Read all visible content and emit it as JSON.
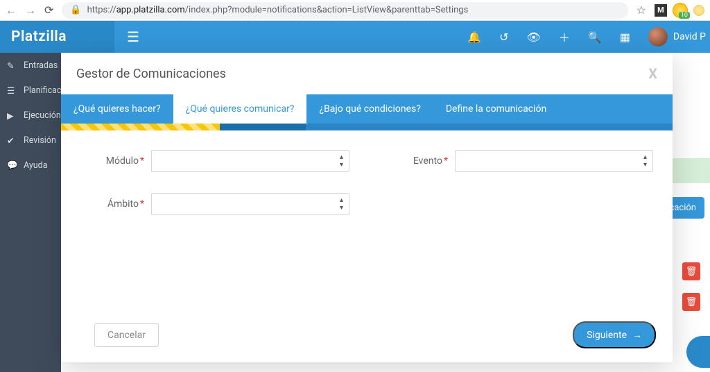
{
  "browser": {
    "url_host": "app.platzilla.com",
    "url_path": "/index.php?module=notifications&action=ListView&parenttab=Settings",
    "ext_m": "M",
    "ext_badge": "10"
  },
  "header": {
    "brand": "Platzilla",
    "user_name": "David P"
  },
  "sidebar": {
    "items": [
      {
        "label": "Entradas"
      },
      {
        "label": "Planificación"
      },
      {
        "label": "Ejecución"
      },
      {
        "label": "Revisión"
      },
      {
        "label": "Ayuda"
      }
    ]
  },
  "bg": {
    "btn_label": "tificación"
  },
  "modal": {
    "title": "Gestor de Comunicaciones",
    "steps": [
      "¿Qué quieres hacer?",
      "¿Qué quieres comunicar?",
      "¿Bajo qué condiciones?",
      "Define la comunicación"
    ],
    "fields": {
      "modulo": "Módulo",
      "evento": "Evento",
      "ambito": "Ámbito"
    },
    "cancel": "Cancelar",
    "next": "Siguiente"
  }
}
